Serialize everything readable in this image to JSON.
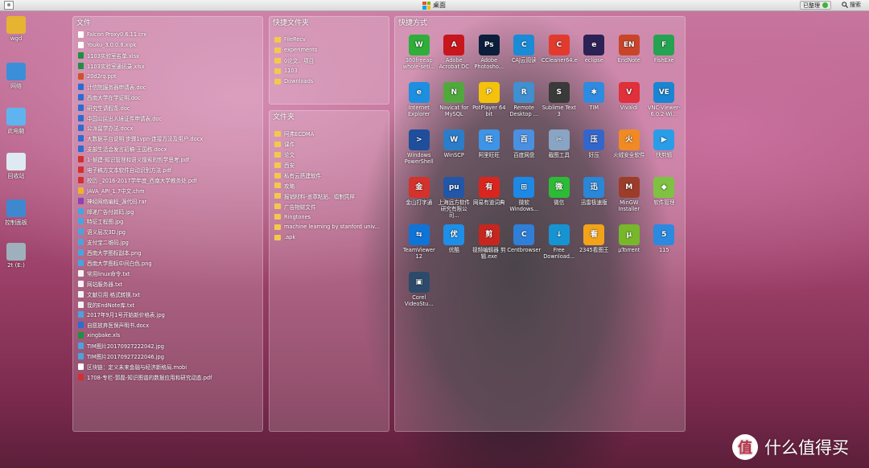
{
  "topbar": {
    "center_label": "桌面",
    "status_label": "已整理",
    "search_label": "搜索"
  },
  "desktop_icons": [
    {
      "label": "wgd",
      "icon": "user-folder-icon",
      "color": "#e6b430"
    },
    {
      "label": "网络",
      "icon": "network-icon",
      "color": "#3a8fd8"
    },
    {
      "label": "此电脑",
      "icon": "computer-icon",
      "color": "#5fb4ef"
    },
    {
      "label": "回收站",
      "icon": "recycle-bin-icon",
      "color": "#dfe9f1"
    },
    {
      "label": "控制面板",
      "icon": "control-panel-icon",
      "color": "#3f88cf"
    },
    {
      "label": "2t (E:)",
      "icon": "drive-icon",
      "color": "#9fb0bd"
    }
  ],
  "files_panel": {
    "title": "文件",
    "items": [
      {
        "name": "Falcon Proxy0.6.11.crx",
        "type": "ffile"
      },
      {
        "name": "Youku_3.0.0.8.xipk",
        "type": "ffile"
      },
      {
        "name": "1103实验室名单.xlsx",
        "type": "fexcel"
      },
      {
        "name": "1103实验室通讯录.xlsx",
        "type": "fexcel"
      },
      {
        "name": "20d2rq.ppt",
        "type": "fppt"
      },
      {
        "name": "计信院服务器申请表.doc",
        "type": "fword"
      },
      {
        "name": "西南大学在学证明.doc",
        "type": "fword"
      },
      {
        "name": "研究生请假条.doc",
        "type": "fword"
      },
      {
        "name": "中国公民出入境证件申请表.doc",
        "type": "fword"
      },
      {
        "name": "公派留学办法.docx",
        "type": "fword"
      },
      {
        "name": "大数据平台说明 步骤1vpn-连接方法及用户.docx",
        "type": "fword"
      },
      {
        "name": "支部生活会发言初稿-王国栋.docx",
        "type": "fword"
      },
      {
        "name": "1-帧建-知识管理和语义搜索的哲学思考.pdf",
        "type": "fpdf"
      },
      {
        "name": "电子稿方文本软件自动识别方法.pdf",
        "type": "fpdf"
      },
      {
        "name": "校历 _2016-2017学年度_西南大学教务处.pdf",
        "type": "fpdf"
      },
      {
        "name": "JAVA_API_1.7中文.chm",
        "type": "fchm"
      },
      {
        "name": "神经网络编程_源代码.rar",
        "type": "fzip"
      },
      {
        "name": "邮递广告付款码.jpg",
        "type": "fimg"
      },
      {
        "name": "特征工程图.jpg",
        "type": "fimg"
      },
      {
        "name": "语义层次3D.jpg",
        "type": "fimg"
      },
      {
        "name": "支付宝二维码.jpg",
        "type": "fimg"
      },
      {
        "name": "西南大学图标副本.png",
        "type": "fimg"
      },
      {
        "name": "西南大学图标中间白色.png",
        "type": "fimg"
      },
      {
        "name": "常用linux命令.txt",
        "type": "ftxt"
      },
      {
        "name": "网站服务器.txt",
        "type": "ftxt"
      },
      {
        "name": "文献引用 格式转换.txt",
        "type": "ftxt"
      },
      {
        "name": "我的EndNote库.txt",
        "type": "ftxt"
      },
      {
        "name": "2017年9月1号开始新价格表.jpg",
        "type": "fimg"
      },
      {
        "name": "自愿放弃医保声明书.docx",
        "type": "fword"
      },
      {
        "name": "xingbake.xls",
        "type": "fexcel"
      },
      {
        "name": "TIM图片20170927222042.jpg",
        "type": "fimg"
      },
      {
        "name": "TIM图片20170927222046.jpg",
        "type": "fimg"
      },
      {
        "name": "区块链：定义未来金融与经济新格局.mobi",
        "type": "ffile"
      },
      {
        "name": "1708-专栏-郭磊-知识图谱的数据应用和研究动态.pdf",
        "type": "fpdf"
      }
    ]
  },
  "quick_folders_panel": {
    "title": "快捷文件夹",
    "items": [
      "FileRecv",
      "experiments",
      "0论文、项目",
      "1103",
      "Downloads"
    ]
  },
  "folders_panel": {
    "title": "文件夹",
    "items": [
      "阿弗ECDMA",
      "课件",
      "论文",
      "西安",
      "私有云搭建软件",
      "攻略",
      "报销材料-盖章粘贴、填制凭样",
      "广告物财文件",
      "Ringtones",
      "machine learning by stanford univ...",
      ".apk"
    ]
  },
  "shortcuts_panel": {
    "title": "快捷方式",
    "items": [
      {
        "label": "360freeap whole-seti...",
        "icon": "360-wifi-icon",
        "color": "#2fae3a",
        "glyph": "W"
      },
      {
        "label": "Adobe Acrobat DC",
        "icon": "acrobat-icon",
        "color": "#c8161d",
        "glyph": "A"
      },
      {
        "label": "Adobe Photosho...",
        "icon": "photoshop-icon",
        "color": "#0b1e3b",
        "glyph": "Ps"
      },
      {
        "label": "CAJ云阅读",
        "icon": "caj-reader-icon",
        "color": "#1a8bd6",
        "glyph": "C"
      },
      {
        "label": "CCleaner64.exe",
        "icon": "ccleaner-icon",
        "color": "#e23b2e",
        "glyph": "C"
      },
      {
        "label": "eclipse",
        "icon": "eclipse-icon",
        "color": "#2c2255",
        "glyph": "e"
      },
      {
        "label": "EndNote",
        "icon": "endnote-icon",
        "color": "#c9452a",
        "glyph": "EN"
      },
      {
        "label": "FishExe",
        "icon": "fish-icon",
        "color": "#25a350",
        "glyph": "F"
      },
      {
        "label": "Internet Explorer",
        "icon": "ie-icon",
        "color": "#1d8fe0",
        "glyph": "e"
      },
      {
        "label": "Navicat for MySQL",
        "icon": "navicat-icon",
        "color": "#51a93d",
        "glyph": "N"
      },
      {
        "label": "PotPlayer 64 bit",
        "icon": "potplayer-icon",
        "color": "#f4c20d",
        "glyph": "P"
      },
      {
        "label": "Remote Desktop ...",
        "icon": "remote-desktop-icon",
        "color": "#3f8fd1",
        "glyph": "R"
      },
      {
        "label": "Sublime Text 3",
        "icon": "sublime-icon",
        "color": "#3a3a3a",
        "glyph": "S"
      },
      {
        "label": "TIM",
        "icon": "tim-icon",
        "color": "#2e8be0",
        "glyph": "✱"
      },
      {
        "label": "Vivaldi",
        "icon": "vivaldi-icon",
        "color": "#e0303a",
        "glyph": "V"
      },
      {
        "label": "VNC-Viewer-6.0.2-Wi...",
        "icon": "vnc-icon",
        "color": "#1a86d3",
        "glyph": "VE"
      },
      {
        "label": "Windows PowerShell",
        "icon": "powershell-icon",
        "color": "#1e4e9c",
        "glyph": ">"
      },
      {
        "label": "WinSCP",
        "icon": "winscp-icon",
        "color": "#2c7dc9",
        "glyph": "W"
      },
      {
        "label": "阿里旺旺",
        "icon": "aliwangwang-icon",
        "color": "#3e94e6",
        "glyph": "旺"
      },
      {
        "label": "百度网盘",
        "icon": "baidu-netdisk-icon",
        "color": "#4a90e2",
        "glyph": "百"
      },
      {
        "label": "截图工具",
        "icon": "snipping-tool-icon",
        "color": "#8aa4c4",
        "glyph": "✂"
      },
      {
        "label": "好压",
        "icon": "haozip-icon",
        "color": "#3366cc",
        "glyph": "压"
      },
      {
        "label": "火绒安全软件",
        "icon": "huorong-icon",
        "color": "#f08a24",
        "glyph": "火"
      },
      {
        "label": "快剪辑",
        "icon": "kuaijianji-icon",
        "color": "#2a9de8",
        "glyph": "▶"
      },
      {
        "label": "金山打字通",
        "icon": "jinshan-typing-icon",
        "color": "#d4322c",
        "glyph": "金"
      },
      {
        "label": "上海远方软件研究有限公司...",
        "icon": "yuanfang-icon",
        "color": "#2256a8",
        "glyph": "pu"
      },
      {
        "label": "网易有道词典",
        "icon": "youdao-icon",
        "color": "#d8261f",
        "glyph": "有"
      },
      {
        "label": "微软 Windows...",
        "icon": "windows-icon",
        "color": "#1e88e5",
        "glyph": "⊞"
      },
      {
        "label": "微信",
        "icon": "wechat-icon",
        "color": "#2dba37",
        "glyph": "微"
      },
      {
        "label": "迅雷极速版",
        "icon": "xunlei-icon",
        "color": "#2a87d8",
        "glyph": "迅"
      },
      {
        "label": "MinGW Installer",
        "icon": "mingw-icon",
        "color": "#9c3d2b",
        "glyph": "M"
      },
      {
        "label": "软件管理",
        "icon": "software-manager-icon",
        "color": "#7fc243",
        "glyph": "◆"
      },
      {
        "label": "TeamViewer 12",
        "icon": "teamviewer-icon",
        "color": "#0f74d8",
        "glyph": "⇆"
      },
      {
        "label": "优酷",
        "icon": "youku-icon",
        "color": "#1e8fe8",
        "glyph": "优"
      },
      {
        "label": "视频编辑器 剪辑.exe",
        "icon": "video-editor-icon",
        "color": "#c7261f",
        "glyph": "剪"
      },
      {
        "label": "Centbrowser",
        "icon": "centbrowser-icon",
        "color": "#2f7fd8",
        "glyph": "C"
      },
      {
        "label": "Free Download...",
        "icon": "free-download-icon",
        "color": "#1694d2",
        "glyph": "↓"
      },
      {
        "label": "2345看图王",
        "icon": "2345-viewer-icon",
        "color": "#f2a31a",
        "glyph": "看"
      },
      {
        "label": "µTorrent",
        "icon": "utorrent-icon",
        "color": "#76b82a",
        "glyph": "µ"
      },
      {
        "label": "115",
        "icon": "115-icon",
        "color": "#2b89df",
        "glyph": "5"
      },
      {
        "label": "Corel VideoStu...",
        "icon": "corel-videostudio-icon",
        "color": "#2d4a6b",
        "glyph": "▣"
      }
    ]
  },
  "watermark": {
    "badge": "值",
    "text": "什么值得买"
  }
}
